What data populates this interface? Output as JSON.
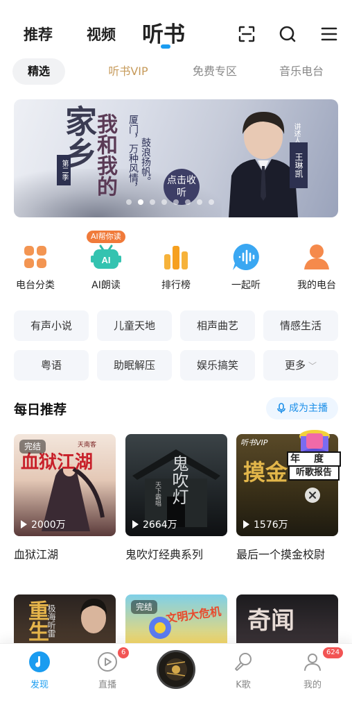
{
  "top_nav": {
    "tabs": [
      {
        "label": "推荐"
      },
      {
        "label": "视频"
      },
      {
        "label": "听书"
      }
    ],
    "active_tab": "听书"
  },
  "sub_tabs": [
    {
      "label": "精选"
    },
    {
      "label": "听书VIP"
    },
    {
      "label": "免费专区"
    },
    {
      "label": "音乐电台"
    }
  ],
  "banner": {
    "title_main": "家乡",
    "title_side": "我和我的",
    "season": "第二季",
    "tagline_1": "厦门，万种风情，",
    "tagline_2": "鼓浪扬帆。",
    "listen_button": "点击收听",
    "narrator_label": "讲述人",
    "narrator": "王琳凯",
    "page_count": 8,
    "active_page": 2
  },
  "features": [
    {
      "label": "电台分类",
      "icon": "grid-icon"
    },
    {
      "label": "AI朗读",
      "icon": "robot-icon",
      "badge": "AI帮你读"
    },
    {
      "label": "排行榜",
      "icon": "bar-chart-icon"
    },
    {
      "label": "一起听",
      "icon": "voice-bubble-icon"
    },
    {
      "label": "我的电台",
      "icon": "user-icon"
    }
  ],
  "categories": [
    {
      "label": "有声小说"
    },
    {
      "label": "儿童天地"
    },
    {
      "label": "相声曲艺"
    },
    {
      "label": "情感生活"
    },
    {
      "label": "粤语"
    },
    {
      "label": "助眠解压"
    },
    {
      "label": "娱乐搞笑"
    },
    {
      "label": "更多"
    }
  ],
  "daily": {
    "title": "每日推荐",
    "host_button": "成为主播",
    "cards": [
      {
        "title": "血狱江湖",
        "plays": "2000万",
        "badge": "完结",
        "cover_text": "血狱江湖",
        "author": "天南客"
      },
      {
        "title": "鬼吹灯经典系列",
        "plays": "2664万",
        "cover_text": "鬼吹灯",
        "author": "天下霸唱"
      },
      {
        "title": "最后一个摸金校尉",
        "plays": "1576万",
        "badge": "听书VIP",
        "cover_text": "摸金"
      }
    ],
    "overlay_badge": {
      "line1": "年度",
      "line2": "听歌报告"
    }
  },
  "row2_cards": [
    {
      "badge": "",
      "cover_text": "重生",
      "side_text": "极海听雷"
    },
    {
      "badge": "完结",
      "cover_text": "文明大危机"
    },
    {
      "badge": "",
      "cover_text": "奇闻"
    }
  ],
  "bottom_nav": [
    {
      "label": "发现",
      "icon": "discover-icon",
      "active": true
    },
    {
      "label": "直播",
      "icon": "live-icon",
      "badge": "6"
    },
    {
      "label": "",
      "icon": "center-album-icon"
    },
    {
      "label": "K歌",
      "icon": "karaoke-icon"
    },
    {
      "label": "我的",
      "icon": "profile-icon",
      "badge": "624"
    }
  ],
  "colors": {
    "accent": "#1a9cf0",
    "vip_gold": "#c69a5a",
    "badge_red": "#f25454",
    "ai_orange": "#f07a3a"
  }
}
